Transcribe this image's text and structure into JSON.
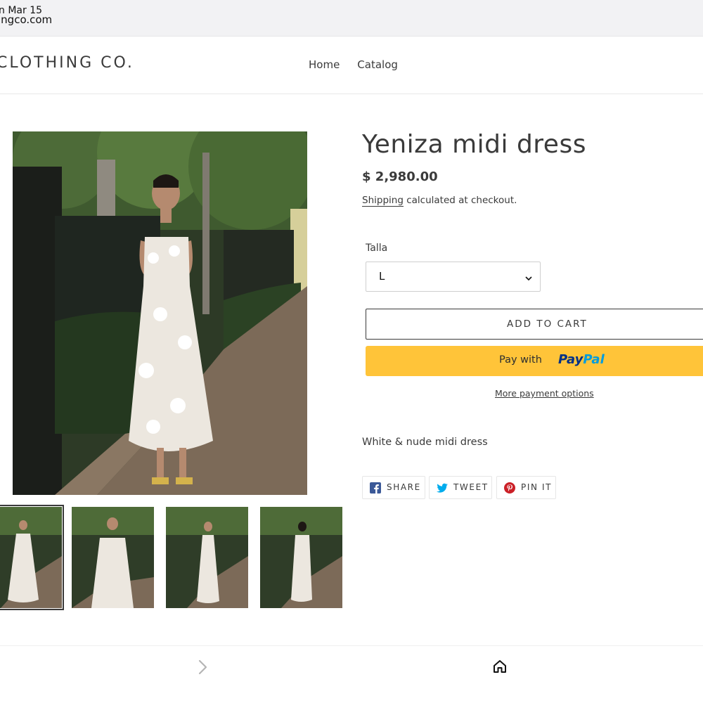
{
  "status_bar": {
    "date": "n Mar 15",
    "url": "ingco.com"
  },
  "header": {
    "logo": "CLOTHING CO.",
    "nav": [
      {
        "label": "Home"
      },
      {
        "label": "Catalog"
      }
    ]
  },
  "product": {
    "title": "Yeniza midi dress",
    "price": "$ 2,980.00",
    "shipping_link": "Shipping",
    "shipping_text": " calculated at checkout.",
    "variant_label": "Talla",
    "variant_value": "L",
    "add_to_cart": "ADD TO CART",
    "paypal_prefix": "Pay with",
    "paypal_pay": "Pay",
    "paypal_pal": "Pal",
    "more_payment": "More payment options",
    "description": "White & nude midi dress",
    "share": [
      {
        "label": "SHARE",
        "icon": "facebook-icon"
      },
      {
        "label": "TWEET",
        "icon": "twitter-icon"
      },
      {
        "label": "PIN IT",
        "icon": "pinterest-icon"
      }
    ],
    "thumbnails": 4
  },
  "colors": {
    "text": "#3a3a3a",
    "paypal_yellow": "#ffc439",
    "paypal_dark": "#003087",
    "paypal_light": "#009cde",
    "facebook": "#3b5998",
    "twitter": "#00aced",
    "pinterest": "#cb2027"
  }
}
